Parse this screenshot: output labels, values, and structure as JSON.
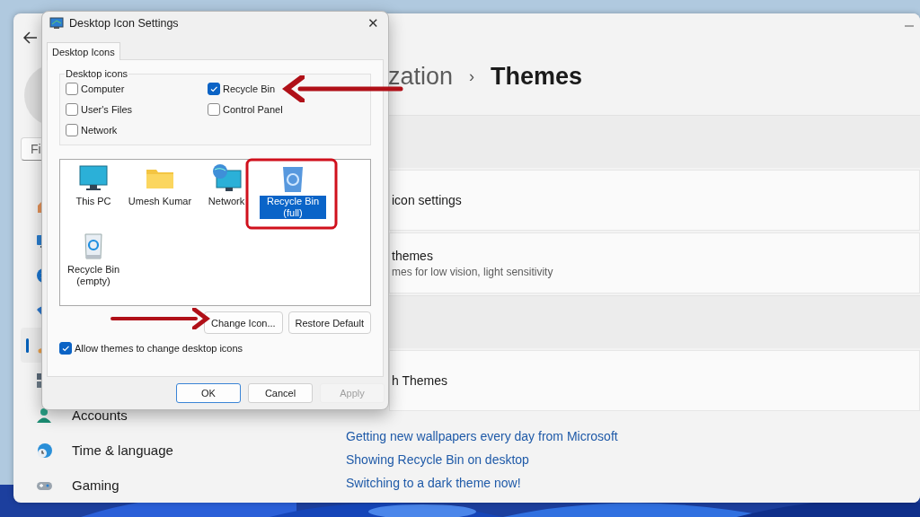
{
  "settings": {
    "search": {
      "placeholder": "Fi"
    },
    "nav": [
      {
        "selected": false
      },
      {
        "selected": false
      },
      {
        "selected": false
      },
      {
        "selected": false
      },
      {
        "selected": true
      },
      {
        "selected": false
      },
      {
        "label": "Accounts",
        "selected": false
      },
      {
        "label": "Time & language",
        "selected": false
      },
      {
        "label": "Gaming",
        "selected": false
      }
    ],
    "breadcrumb": {
      "parent": "zation",
      "separator": "›",
      "current": "Themes"
    },
    "cards": [
      {
        "kind": "band"
      },
      {
        "kind": "card",
        "title": "icon settings"
      },
      {
        "kind": "card",
        "title": "themes",
        "subtitle": "mes for low vision, light sensitivity"
      },
      {
        "kind": "band"
      },
      {
        "kind": "card",
        "title": "h Themes"
      }
    ],
    "links": [
      "Getting new wallpapers every day from Microsoft",
      "Showing Recycle Bin on desktop",
      "Switching to a dark theme now!"
    ]
  },
  "dialog": {
    "title": "Desktop Icon Settings",
    "close": "✕",
    "tabs": [
      {
        "label": "Desktop Icons",
        "selected": true
      }
    ],
    "group_title": "Desktop icons",
    "checkboxes": [
      {
        "label": "Computer",
        "checked": false
      },
      {
        "label": "Recycle Bin",
        "checked": true
      },
      {
        "label": "User's Files",
        "checked": false
      },
      {
        "label": "Control Panel",
        "checked": false
      },
      {
        "label": "Network",
        "checked": false
      }
    ],
    "icons": [
      {
        "kind": "pc",
        "label": "This PC",
        "selected": false
      },
      {
        "kind": "folder",
        "label": "Umesh Kumar",
        "selected": false
      },
      {
        "kind": "network",
        "label": "Network",
        "selected": false
      },
      {
        "kind": "bin-full",
        "label": "Recycle Bin (full)",
        "selected": true
      },
      {
        "kind": "bin-empty",
        "label": "Recycle Bin (empty)",
        "selected": false
      }
    ],
    "icon_buttons": [
      "Change Icon...",
      "Restore Default"
    ],
    "allow_themes": {
      "label": "Allow themes to change desktop icons",
      "checked": true
    },
    "buttons": [
      {
        "label": "OK",
        "default": true,
        "disabled": false
      },
      {
        "label": "Cancel",
        "default": false,
        "disabled": false
      },
      {
        "label": "Apply",
        "default": false,
        "disabled": true
      }
    ]
  }
}
